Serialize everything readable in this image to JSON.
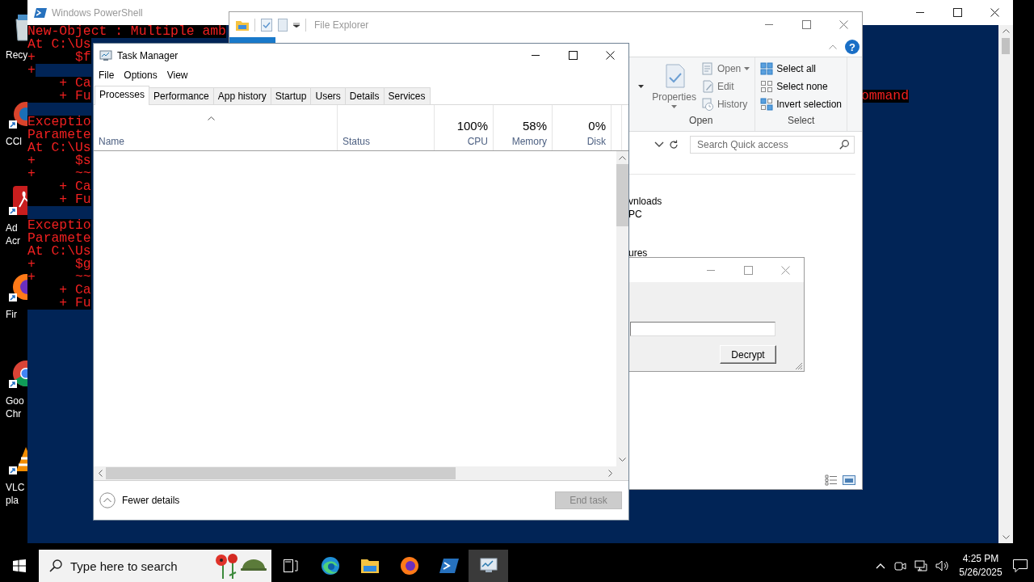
{
  "desktop_icons": [
    {
      "kind": "recycle_bin",
      "label": [
        "Recy"
      ]
    },
    {
      "kind": "ccleaner",
      "label": [
        "CCl"
      ]
    },
    {
      "kind": "acrobat",
      "label": [
        "Ad",
        "Acr"
      ]
    },
    {
      "kind": "firefox",
      "label": [
        "Fir"
      ]
    },
    {
      "kind": "chrome",
      "label": [
        "Goo",
        "Chr"
      ]
    },
    {
      "kind": "vlc",
      "label": [
        "VLC",
        "pla"
      ]
    }
  ],
  "powershell": {
    "title": "Windows PowerShell",
    "lines": [
      {
        "kind": "error",
        "text": "New-Object : Multiple amb"
      },
      {
        "kind": "error",
        "text": "At C:\\Us"
      },
      {
        "kind": "error",
        "text": "+     $f"
      },
      {
        "kind": "error",
        "text": "+"
      },
      {
        "kind": "error",
        "text": "    + Ca"
      },
      {
        "kind": "error",
        "text": "    + Fu",
        "tail": "ommand"
      },
      {
        "kind": "blank"
      },
      {
        "kind": "error",
        "text": "Exceptio"
      },
      {
        "kind": "error",
        "text": "Paramete"
      },
      {
        "kind": "error",
        "text": "At C:\\Us"
      },
      {
        "kind": "error",
        "text": "+     $s"
      },
      {
        "kind": "error",
        "text": "+     ~~"
      },
      {
        "kind": "error",
        "text": "    + Ca"
      },
      {
        "kind": "error",
        "text": "    + Fu"
      },
      {
        "kind": "blank"
      },
      {
        "kind": "error",
        "text": "Exceptio"
      },
      {
        "kind": "error",
        "text": "Paramete"
      },
      {
        "kind": "error",
        "text": "At C:\\Us"
      },
      {
        "kind": "error",
        "text": "+     $g"
      },
      {
        "kind": "error",
        "text": "+     ~~"
      },
      {
        "kind": "error",
        "text": "    + Ca"
      },
      {
        "kind": "error",
        "text": "    + Fu"
      }
    ]
  },
  "file_explorer": {
    "title": "File Explorer",
    "help": "?",
    "ribbon": {
      "groups": [
        {
          "label": "Open",
          "items": [
            {
              "kind": "properties",
              "label": "Properties",
              "dropdown": true,
              "disabled": true
            },
            {
              "kind": "open",
              "label": "Open",
              "dropdown": true,
              "disabled": true
            },
            {
              "kind": "edit",
              "label": "Edit",
              "dropdown": false,
              "disabled": true
            },
            {
              "kind": "history",
              "label": "History",
              "dropdown": false,
              "disabled": true
            }
          ]
        },
        {
          "label": "Select",
          "items": [
            {
              "kind": "select_all",
              "label": "Select all",
              "dropdown": false,
              "disabled": false
            },
            {
              "kind": "select_none",
              "label": "Select none",
              "dropdown": false,
              "disabled": false
            },
            {
              "kind": "invert_selection",
              "label": "Invert selection",
              "dropdown": false,
              "disabled": false
            }
          ]
        }
      ]
    },
    "search": {
      "placeholder": "Search Quick access"
    },
    "nav_items": [
      "vnloads",
      "PC",
      "ures"
    ]
  },
  "dialog": {
    "button": "Decrypt"
  },
  "task_manager": {
    "title": "Task Manager",
    "menu": [
      "File",
      "Options",
      "View"
    ],
    "tabs": [
      {
        "label": "Processes",
        "selected": true
      },
      {
        "label": "Performance",
        "selected": false
      },
      {
        "label": "App history",
        "selected": false
      },
      {
        "label": "Startup",
        "selected": false
      },
      {
        "label": "Users",
        "selected": false
      },
      {
        "label": "Details",
        "selected": false
      },
      {
        "label": "Services",
        "selected": false
      }
    ],
    "columns": [
      {
        "label": "Name"
      },
      {
        "label": "Status"
      },
      {
        "label": "CPU",
        "value": "100%"
      },
      {
        "label": "Memory",
        "value": "58%"
      },
      {
        "label": "Disk",
        "value": "0%"
      }
    ],
    "footer": {
      "toggle": "Fewer details",
      "end_task": {
        "label": "End task",
        "disabled": true
      }
    }
  },
  "taskbar": {
    "search": {
      "placeholder": "Type here to search"
    },
    "apps": [
      {
        "kind": "edge",
        "selected": false
      },
      {
        "kind": "explorer",
        "selected": false
      },
      {
        "kind": "firefox",
        "selected": false
      },
      {
        "kind": "powershell",
        "selected": false
      },
      {
        "kind": "task_manager",
        "selected": true
      }
    ],
    "time": "4:25 PM",
    "date": "5/26/2025"
  }
}
